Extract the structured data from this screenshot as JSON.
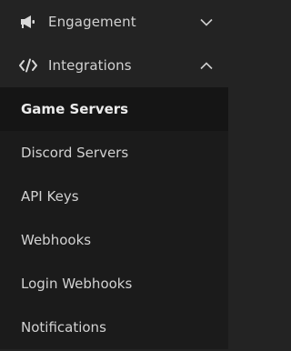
{
  "nav": {
    "groups": [
      {
        "label": "Engagement",
        "icon": "megaphone-icon",
        "expanded": false
      },
      {
        "label": "Integrations",
        "icon": "code-icon",
        "expanded": true,
        "items": [
          {
            "label": "Game Servers",
            "active": true
          },
          {
            "label": "Discord Servers",
            "active": false
          },
          {
            "label": "API Keys",
            "active": false
          },
          {
            "label": "Webhooks",
            "active": false
          },
          {
            "label": "Login Webhooks",
            "active": false
          },
          {
            "label": "Notifications",
            "active": false
          }
        ]
      }
    ]
  }
}
